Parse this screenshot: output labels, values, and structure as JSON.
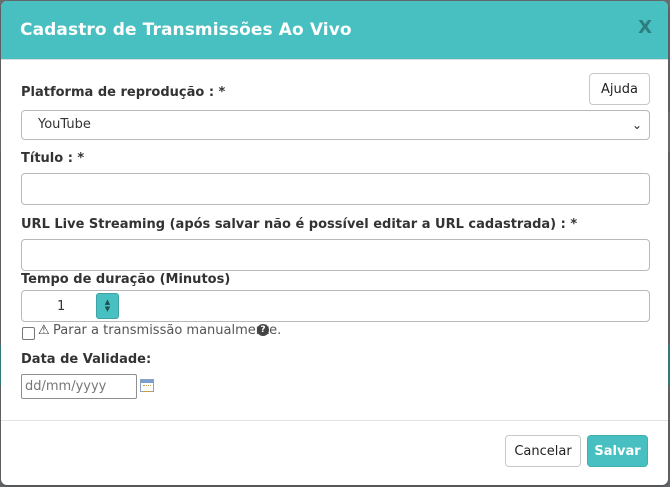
{
  "modal": {
    "title": "Cadastro de Transmissões Ao Vivo",
    "close_label": "X"
  },
  "form": {
    "platform_label": "Platforma de reprodução : *",
    "help_button": "Ajuda",
    "platform_selected": "YouTube",
    "title_label": "Título : *",
    "title_value": "",
    "url_label": "URL Live Streaming (após salvar não é possível editar a URL cadastrada) : *",
    "url_value": "",
    "duration_label": "Tempo de duração (Minutos)",
    "duration_value": "1",
    "manual_stop_label": "Parar a transmissão manualmente.",
    "manual_stop_checked": false,
    "validity_label": "Data de Validade:",
    "validity_placeholder": "dd/mm/yyyy"
  },
  "footer": {
    "cancel_button": "Cancelar",
    "save_button": "Salvar"
  },
  "colors": {
    "accent": "#48bfc1",
    "header_text": "#ffffff",
    "close_icon": "#2e7e80"
  },
  "icons": {
    "close": "close-icon",
    "select_chevron": "chevron-down-icon",
    "stepper": "stepper-arrows-icon",
    "warning": "warning-icon",
    "help": "question-circle-icon",
    "calendar": "calendar-icon"
  }
}
